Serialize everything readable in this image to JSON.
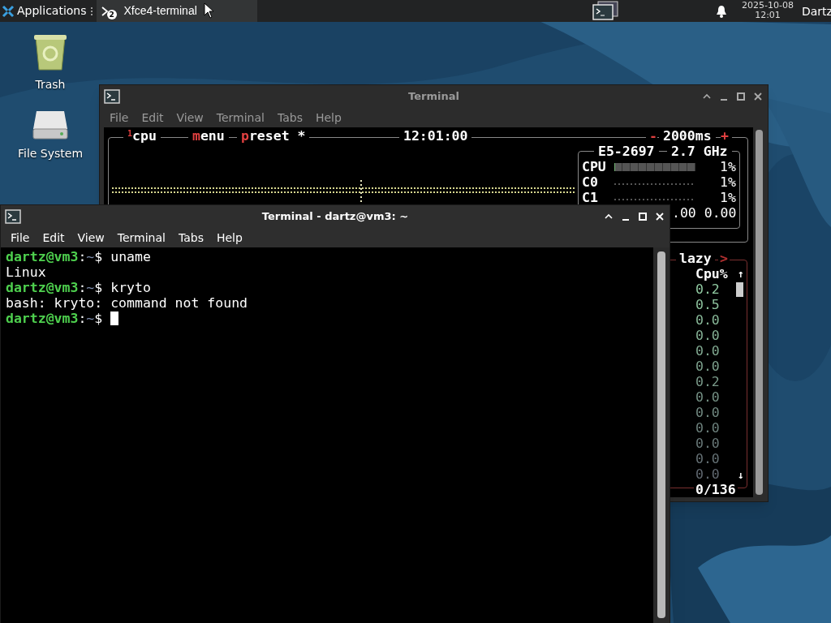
{
  "panel": {
    "applications": "Applications",
    "tasks": [
      {
        "label": "Xfce4-terminal",
        "badge": "2",
        "selected": true
      }
    ],
    "clock": {
      "date": "2025-10-08",
      "time": "12:01"
    },
    "user": "Dartz"
  },
  "desktop_icons": [
    {
      "label": "Trash",
      "kind": "trash"
    },
    {
      "label": "File System",
      "kind": "drive"
    }
  ],
  "back_window": {
    "title": "Terminal",
    "active": false,
    "menu": [
      "File",
      "Edit",
      "View",
      "Terminal",
      "Tabs",
      "Help"
    ],
    "btop": {
      "tabs": [
        {
          "number": "1",
          "label": "cpu"
        },
        {
          "hotkey": "m",
          "label": "enu"
        },
        {
          "hotkey": "p",
          "label": "reset *"
        }
      ],
      "clock": "12:01:00",
      "minus": "-",
      "interval": "2000ms",
      "plus": "+",
      "cpu_model": "E5-2697",
      "cpu_freq": "2.7 GHz",
      "cpu_rows": [
        {
          "label": "CPU",
          "level": 0.01,
          "reading": "1%"
        },
        {
          "label": "C0",
          "reading": "1%"
        },
        {
          "label": "C1",
          "reading": "1%"
        }
      ],
      "load": ".00 0.00",
      "proc": {
        "filter": "lazy",
        "arrow": ">",
        "column": "Cpu%",
        "up": "↑",
        "down": "↓",
        "count": "0/136",
        "values": [
          "0.2",
          "0.5",
          "0.0",
          "0.0",
          "0.0",
          "0.0",
          "0.2",
          "0.0",
          "0.0",
          "0.0",
          "0.0",
          "0.0",
          "0.0"
        ]
      }
    }
  },
  "front_window": {
    "title": "Terminal - dartz@vm3: ~",
    "active": true,
    "menu": [
      "File",
      "Edit",
      "View",
      "Terminal",
      "Tabs",
      "Help"
    ],
    "lines": [
      {
        "kind": "prompt",
        "user": "dartz@vm3",
        "sep": ":",
        "path": "~",
        "symbol": "$",
        "command": "uname",
        "cursor": false
      },
      {
        "kind": "output",
        "text": "Linux"
      },
      {
        "kind": "prompt",
        "user": "dartz@vm3",
        "sep": ":",
        "path": "~",
        "symbol": "$",
        "command": "kryto",
        "cursor": false
      },
      {
        "kind": "output",
        "text": "bash: kryto: command not found"
      },
      {
        "kind": "prompt",
        "user": "dartz@vm3",
        "sep": ":",
        "path": "~",
        "symbol": "$",
        "cursor": true
      }
    ]
  }
}
